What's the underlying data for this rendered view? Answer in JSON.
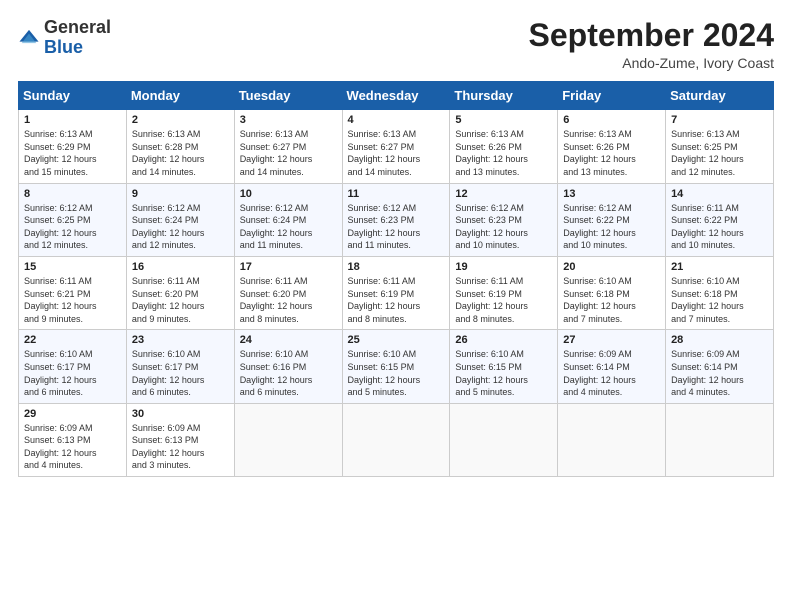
{
  "header": {
    "logo": {
      "general": "General",
      "blue": "Blue"
    },
    "title": "September 2024",
    "subtitle": "Ando-Zume, Ivory Coast"
  },
  "days_of_week": [
    "Sunday",
    "Monday",
    "Tuesday",
    "Wednesday",
    "Thursday",
    "Friday",
    "Saturday"
  ],
  "weeks": [
    [
      {
        "day": "1",
        "sunrise": "6:13 AM",
        "sunset": "6:29 PM",
        "daylight": "12 hours and 15 minutes."
      },
      {
        "day": "2",
        "sunrise": "6:13 AM",
        "sunset": "6:28 PM",
        "daylight": "12 hours and 14 minutes."
      },
      {
        "day": "3",
        "sunrise": "6:13 AM",
        "sunset": "6:27 PM",
        "daylight": "12 hours and 14 minutes."
      },
      {
        "day": "4",
        "sunrise": "6:13 AM",
        "sunset": "6:27 PM",
        "daylight": "12 hours and 14 minutes."
      },
      {
        "day": "5",
        "sunrise": "6:13 AM",
        "sunset": "6:26 PM",
        "daylight": "12 hours and 13 minutes."
      },
      {
        "day": "6",
        "sunrise": "6:13 AM",
        "sunset": "6:26 PM",
        "daylight": "12 hours and 13 minutes."
      },
      {
        "day": "7",
        "sunrise": "6:13 AM",
        "sunset": "6:25 PM",
        "daylight": "12 hours and 12 minutes."
      }
    ],
    [
      {
        "day": "8",
        "sunrise": "6:12 AM",
        "sunset": "6:25 PM",
        "daylight": "12 hours and 12 minutes."
      },
      {
        "day": "9",
        "sunrise": "6:12 AM",
        "sunset": "6:24 PM",
        "daylight": "12 hours and 12 minutes."
      },
      {
        "day": "10",
        "sunrise": "6:12 AM",
        "sunset": "6:24 PM",
        "daylight": "12 hours and 11 minutes."
      },
      {
        "day": "11",
        "sunrise": "6:12 AM",
        "sunset": "6:23 PM",
        "daylight": "12 hours and 11 minutes."
      },
      {
        "day": "12",
        "sunrise": "6:12 AM",
        "sunset": "6:23 PM",
        "daylight": "12 hours and 10 minutes."
      },
      {
        "day": "13",
        "sunrise": "6:12 AM",
        "sunset": "6:22 PM",
        "daylight": "12 hours and 10 minutes."
      },
      {
        "day": "14",
        "sunrise": "6:11 AM",
        "sunset": "6:22 PM",
        "daylight": "12 hours and 10 minutes."
      }
    ],
    [
      {
        "day": "15",
        "sunrise": "6:11 AM",
        "sunset": "6:21 PM",
        "daylight": "12 hours and 9 minutes."
      },
      {
        "day": "16",
        "sunrise": "6:11 AM",
        "sunset": "6:20 PM",
        "daylight": "12 hours and 9 minutes."
      },
      {
        "day": "17",
        "sunrise": "6:11 AM",
        "sunset": "6:20 PM",
        "daylight": "12 hours and 8 minutes."
      },
      {
        "day": "18",
        "sunrise": "6:11 AM",
        "sunset": "6:19 PM",
        "daylight": "12 hours and 8 minutes."
      },
      {
        "day": "19",
        "sunrise": "6:11 AM",
        "sunset": "6:19 PM",
        "daylight": "12 hours and 8 minutes."
      },
      {
        "day": "20",
        "sunrise": "6:10 AM",
        "sunset": "6:18 PM",
        "daylight": "12 hours and 7 minutes."
      },
      {
        "day": "21",
        "sunrise": "6:10 AM",
        "sunset": "6:18 PM",
        "daylight": "12 hours and 7 minutes."
      }
    ],
    [
      {
        "day": "22",
        "sunrise": "6:10 AM",
        "sunset": "6:17 PM",
        "daylight": "12 hours and 6 minutes."
      },
      {
        "day": "23",
        "sunrise": "6:10 AM",
        "sunset": "6:17 PM",
        "daylight": "12 hours and 6 minutes."
      },
      {
        "day": "24",
        "sunrise": "6:10 AM",
        "sunset": "6:16 PM",
        "daylight": "12 hours and 6 minutes."
      },
      {
        "day": "25",
        "sunrise": "6:10 AM",
        "sunset": "6:15 PM",
        "daylight": "12 hours and 5 minutes."
      },
      {
        "day": "26",
        "sunrise": "6:10 AM",
        "sunset": "6:15 PM",
        "daylight": "12 hours and 5 minutes."
      },
      {
        "day": "27",
        "sunrise": "6:09 AM",
        "sunset": "6:14 PM",
        "daylight": "12 hours and 4 minutes."
      },
      {
        "day": "28",
        "sunrise": "6:09 AM",
        "sunset": "6:14 PM",
        "daylight": "12 hours and 4 minutes."
      }
    ],
    [
      {
        "day": "29",
        "sunrise": "6:09 AM",
        "sunset": "6:13 PM",
        "daylight": "12 hours and 4 minutes."
      },
      {
        "day": "30",
        "sunrise": "6:09 AM",
        "sunset": "6:13 PM",
        "daylight": "12 hours and 3 minutes."
      },
      null,
      null,
      null,
      null,
      null
    ]
  ]
}
